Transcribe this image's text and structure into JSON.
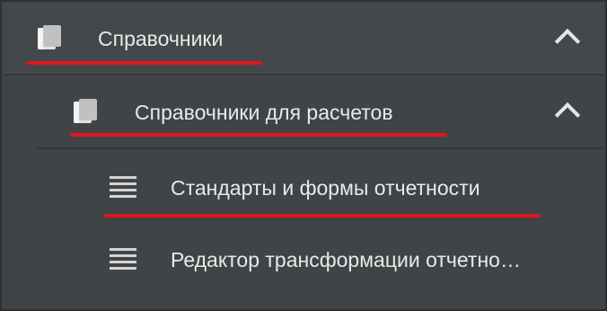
{
  "menu": {
    "top": {
      "label": "Справочники",
      "icon": "book-icon",
      "state": "expanded"
    },
    "sub": {
      "label": "Справочники для расчетов",
      "icon": "book-icon",
      "state": "expanded"
    },
    "items": [
      {
        "label": "Стандарты и формы отчетности",
        "icon": "list-icon"
      },
      {
        "label": "Редактор трансформации отчетно…",
        "icon": "list-icon"
      }
    ]
  },
  "colors": {
    "background": "#414446",
    "text": "#e9e9e9",
    "highlight": "#e0151e"
  }
}
